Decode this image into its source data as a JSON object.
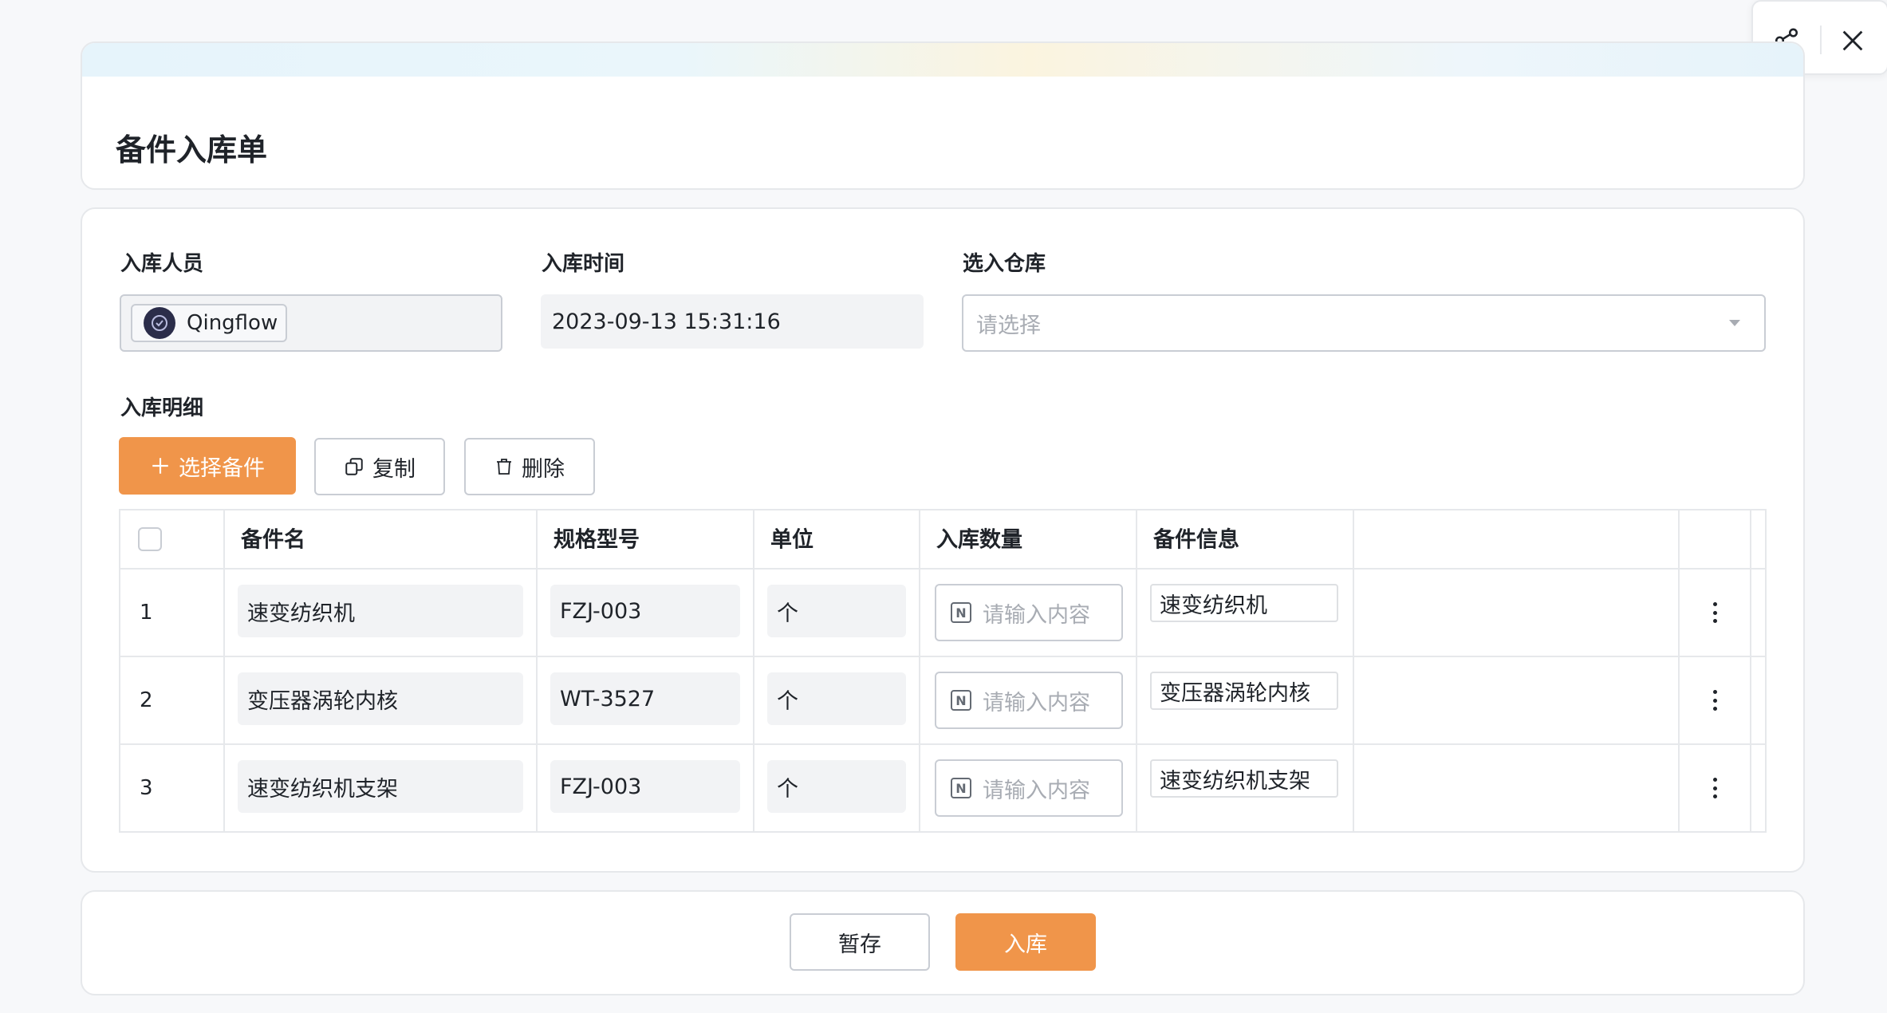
{
  "title": "备件入库单",
  "form": {
    "operator": {
      "label": "入库人员",
      "value": "Qingflow"
    },
    "time": {
      "label": "入库时间",
      "value": "2023-09-13 15:31:16"
    },
    "warehouse": {
      "label": "选入仓库",
      "placeholder": "请选择"
    }
  },
  "detail": {
    "label": "入库明细",
    "buttons": {
      "select": "选择备件",
      "copy": "复制",
      "delete": "删除"
    },
    "columns": [
      "备件名",
      "规格型号",
      "单位",
      "入库数量",
      "备件信息"
    ],
    "rows": [
      {
        "index": "1",
        "name": "速变纺织机",
        "model": "FZJ-003",
        "unit": "个",
        "qty_placeholder": "请输入内容",
        "info": "速变纺织机"
      },
      {
        "index": "2",
        "name": "变压器涡轮内核",
        "model": "WT-3527",
        "unit": "个",
        "qty_placeholder": "请输入内容",
        "info": "变压器涡轮内核"
      },
      {
        "index": "3",
        "name": "速变纺织机支架",
        "model": "FZJ-003",
        "unit": "个",
        "qty_placeholder": "请输入内容",
        "info": "速变纺织机支架"
      }
    ]
  },
  "footer": {
    "save": "暂存",
    "submit": "入库"
  },
  "colors": {
    "primary": "#f0954a",
    "border": "#c9cdd4",
    "readonly_bg": "#f2f3f5"
  },
  "icons": [
    "share-icon",
    "close-icon",
    "plus-icon",
    "copy-icon",
    "trash-icon",
    "number-icon",
    "more-vertical-icon",
    "chevron-down-icon",
    "avatar"
  ]
}
